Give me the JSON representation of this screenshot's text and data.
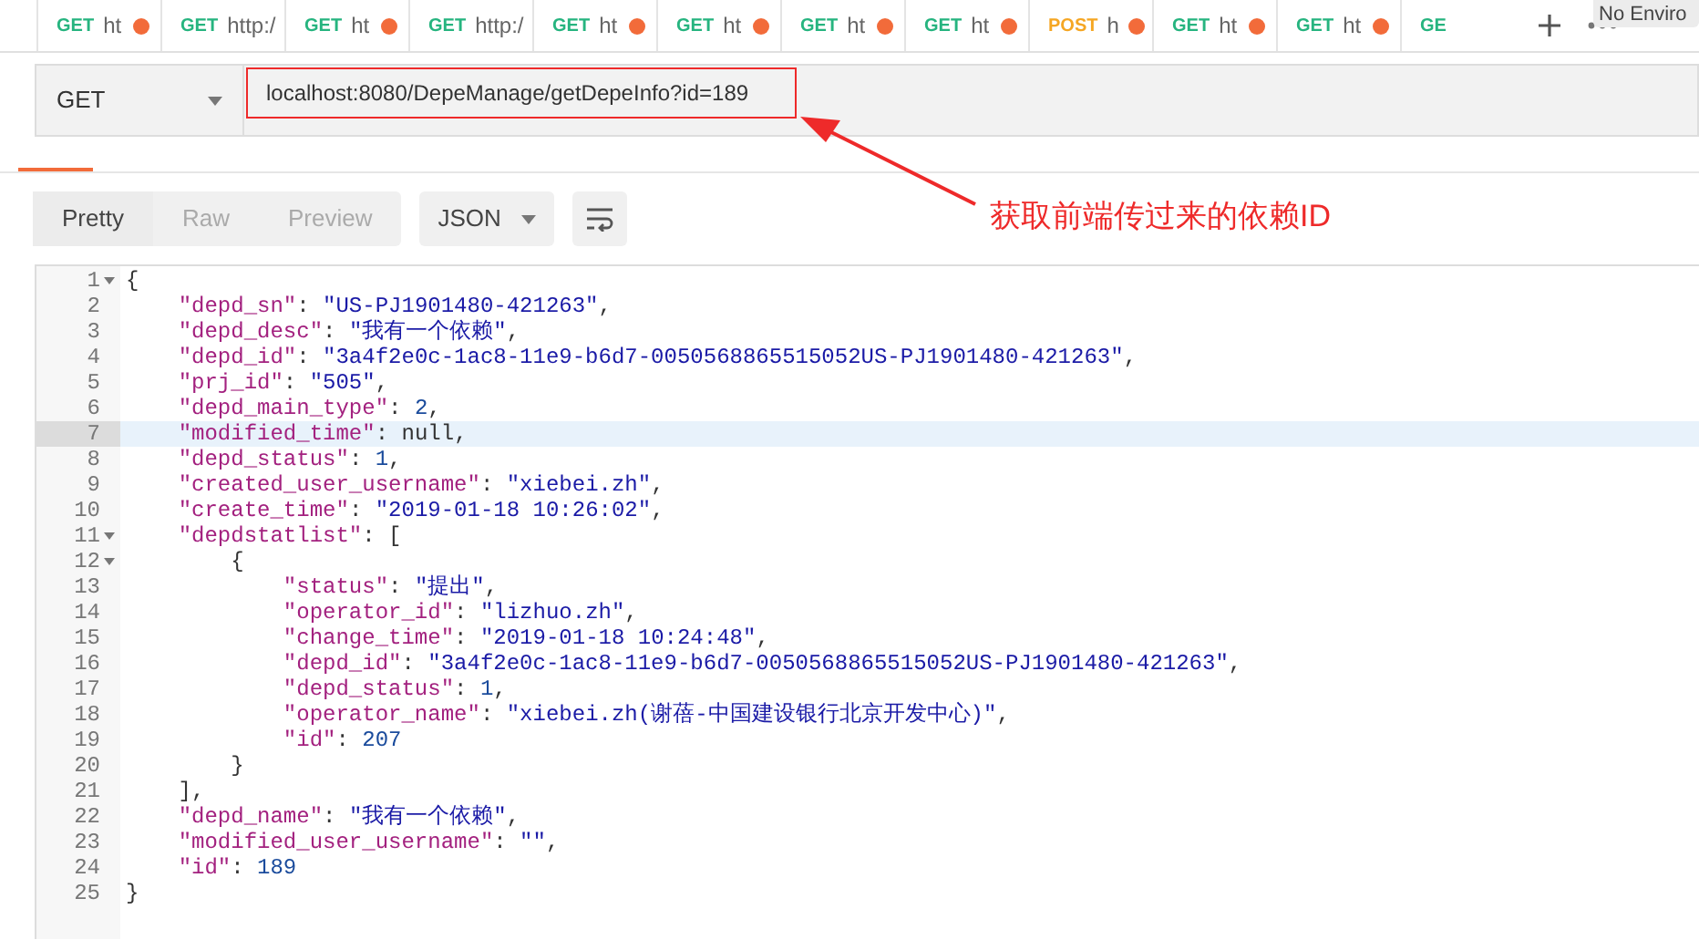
{
  "tabs": [
    {
      "method": "GET",
      "url": "ht",
      "unsaved": true
    },
    {
      "method": "GET",
      "url": "http:/",
      "unsaved": false
    },
    {
      "method": "GET",
      "url": "ht",
      "unsaved": true
    },
    {
      "method": "GET",
      "url": "http:/",
      "unsaved": false
    },
    {
      "method": "GET",
      "url": "ht",
      "unsaved": true
    },
    {
      "method": "GET",
      "url": "ht",
      "unsaved": true
    },
    {
      "method": "GET",
      "url": "ht",
      "unsaved": true
    },
    {
      "method": "GET",
      "url": "ht",
      "unsaved": true
    },
    {
      "method": "POST",
      "url": "h",
      "unsaved": true
    },
    {
      "method": "GET",
      "url": "ht",
      "unsaved": true
    },
    {
      "method": "GET",
      "url": "ht",
      "unsaved": true
    },
    {
      "method": "GE",
      "unsaved": false
    }
  ],
  "environment": "No Enviro",
  "request": {
    "method": "GET",
    "url": "localhost:8080/DepeManage/getDepeInfo?id=189"
  },
  "annotation": "获取前端传过来的依赖ID",
  "view_modes": [
    {
      "label": "Pretty",
      "selected": true
    },
    {
      "label": "Raw",
      "selected": false
    },
    {
      "label": "Preview",
      "selected": false
    }
  ],
  "format": "JSON",
  "code_lines": [
    {
      "number": "1",
      "text": "{",
      "foldable": true,
      "highlighted": false
    },
    {
      "number": "2",
      "text": "    \"depd_sn\": \"US-PJ1901480-421263\",",
      "foldable": false,
      "highlighted": false
    },
    {
      "number": "3",
      "text": "    \"depd_desc\": \"我有一个依赖\",",
      "foldable": false,
      "highlighted": false
    },
    {
      "number": "4",
      "text": "    \"depd_id\": \"3a4f2e0c-1ac8-11e9-b6d7-0050568865515052US-PJ1901480-421263\",",
      "foldable": false,
      "highlighted": false
    },
    {
      "number": "5",
      "text": "    \"prj_id\": \"505\",",
      "foldable": false,
      "highlighted": false
    },
    {
      "number": "6",
      "text": "    \"depd_main_type\": 2,",
      "foldable": false,
      "highlighted": false
    },
    {
      "number": "7",
      "text": "    \"modified_time\": null,",
      "foldable": false,
      "highlighted": true
    },
    {
      "number": "8",
      "text": "    \"depd_status\": 1,",
      "foldable": false,
      "highlighted": false
    },
    {
      "number": "9",
      "text": "    \"created_user_username\": \"xiebei.zh\",",
      "foldable": false,
      "highlighted": false
    },
    {
      "number": "10",
      "text": "    \"create_time\": \"2019-01-18 10:26:02\",",
      "foldable": false,
      "highlighted": false
    },
    {
      "number": "11",
      "text": "    \"depdstatlist\": [",
      "foldable": true,
      "highlighted": false
    },
    {
      "number": "12",
      "text": "        {",
      "foldable": true,
      "highlighted": false
    },
    {
      "number": "13",
      "text": "            \"status\": \"提出\",",
      "foldable": false,
      "highlighted": false
    },
    {
      "number": "14",
      "text": "            \"operator_id\": \"lizhuo.zh\",",
      "foldable": false,
      "highlighted": false
    },
    {
      "number": "15",
      "text": "            \"change_time\": \"2019-01-18 10:24:48\",",
      "foldable": false,
      "highlighted": false
    },
    {
      "number": "16",
      "text": "            \"depd_id\": \"3a4f2e0c-1ac8-11e9-b6d7-0050568865515052US-PJ1901480-421263\",",
      "foldable": false,
      "highlighted": false
    },
    {
      "number": "17",
      "text": "            \"depd_status\": 1,",
      "foldable": false,
      "highlighted": false
    },
    {
      "number": "18",
      "text": "            \"operator_name\": \"xiebei.zh(谢蓓-中国建设银行北京开发中心)\",",
      "foldable": false,
      "highlighted": false
    },
    {
      "number": "19",
      "text": "            \"id\": 207",
      "foldable": false,
      "highlighted": false
    },
    {
      "number": "20",
      "text": "        }",
      "foldable": false,
      "highlighted": false
    },
    {
      "number": "21",
      "text": "    ],",
      "foldable": false,
      "highlighted": false
    },
    {
      "number": "22",
      "text": "    \"depd_name\": \"我有一个依赖\",",
      "foldable": false,
      "highlighted": false
    },
    {
      "number": "23",
      "text": "    \"modified_user_username\": \"\",",
      "foldable": false,
      "highlighted": false
    },
    {
      "number": "24",
      "text": "    \"id\": 189",
      "foldable": false,
      "highlighted": false
    },
    {
      "number": "25",
      "text": "}",
      "foldable": false,
      "highlighted": false
    }
  ]
}
